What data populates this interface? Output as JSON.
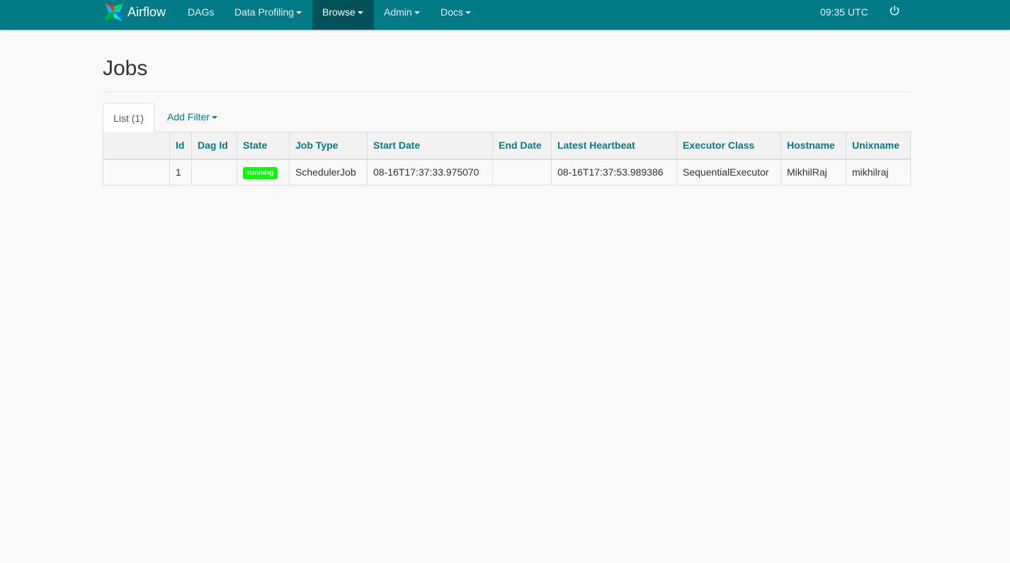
{
  "navbar": {
    "brand": "Airflow",
    "items": [
      {
        "label": "DAGs"
      },
      {
        "label": "Data Profiling"
      },
      {
        "label": "Browse"
      },
      {
        "label": "Admin"
      },
      {
        "label": "Docs"
      }
    ],
    "active": "Browse",
    "clock": "09:35 UTC",
    "logout_icon": "power-icon",
    "bg_color": "#017b86",
    "active_color": "#015259"
  },
  "page": {
    "title": "Jobs"
  },
  "tabs": {
    "list_label": "List (1)",
    "filter_label": "Add Filter"
  },
  "table": {
    "columns": [
      "",
      "Id",
      "Dag Id",
      "State",
      "Job Type",
      "Start Date",
      "End Date",
      "Latest Heartbeat",
      "Executor Class",
      "Hostname",
      "Unixname"
    ],
    "rows": [
      {
        "id": "1",
        "dag_id": "",
        "state": "running",
        "job_type": "SchedulerJob",
        "start_date": "08-16T17:37:33.975070",
        "end_date": "",
        "latest_heartbeat": "08-16T17:37:53.989386",
        "executor_class": "SequentialExecutor",
        "hostname": "MikhilRaj",
        "unixname": "mikhilraj"
      }
    ],
    "state_color": "#01fe01"
  }
}
